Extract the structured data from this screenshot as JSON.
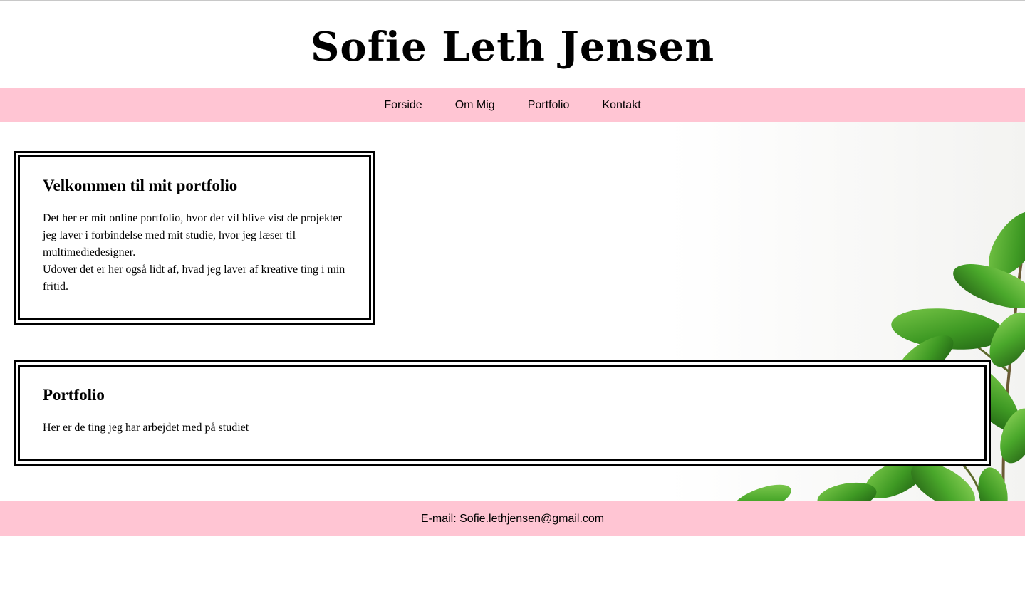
{
  "header": {
    "title": "Sofie Leth Jensen"
  },
  "nav": {
    "items": [
      {
        "label": "Forside"
      },
      {
        "label": "Om Mig"
      },
      {
        "label": "Portfolio"
      },
      {
        "label": "Kontakt"
      }
    ]
  },
  "welcome": {
    "title": "Velkommen til mit portfolio",
    "paragraph1": "Det her er mit online portfolio, hvor der vil blive vist de projekter jeg laver i forbindelse med mit studie, hvor jeg læser til multimediedesigner.",
    "paragraph2": "Udover det er her også lidt af, hvad jeg laver af kreative ting i min fritid."
  },
  "portfolio": {
    "title": "Portfolio",
    "text": "Her er de ting jeg har arbejdet med på studiet"
  },
  "footer": {
    "prefix": "E-mail: ",
    "email": "Sofie.lethjensen@gmail.com"
  },
  "colors": {
    "accent_pink": "#ffc5d3",
    "leaf_green": "#3f9a24",
    "text": "#000000"
  }
}
